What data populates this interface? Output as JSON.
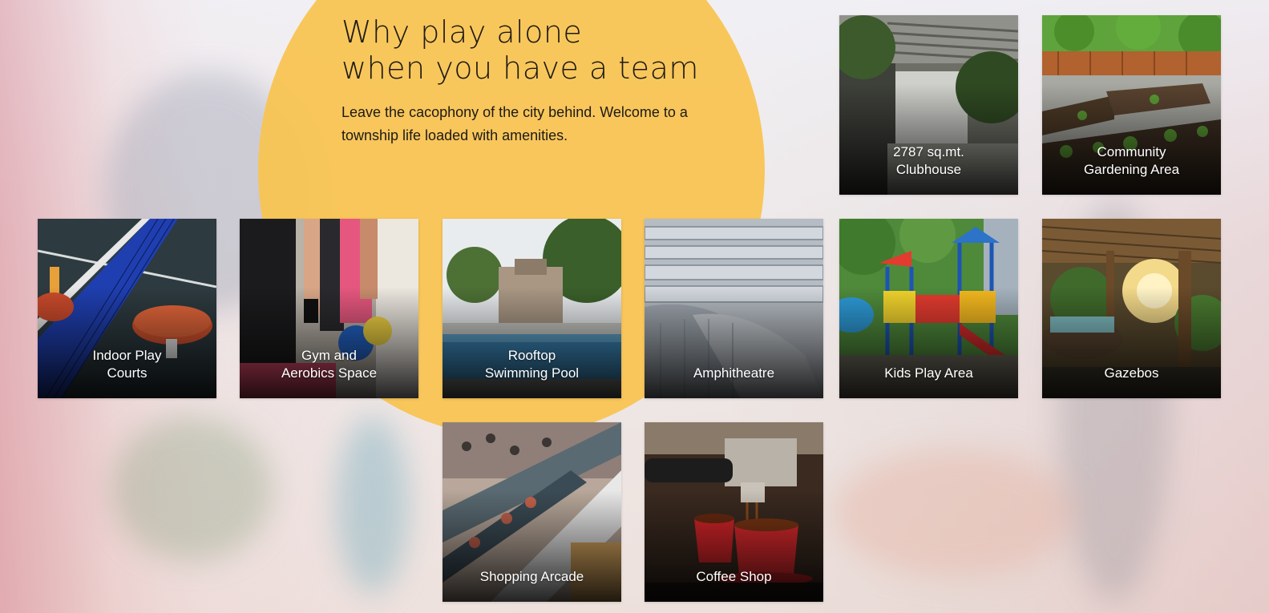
{
  "hero": {
    "headline_line1": "Why play alone",
    "headline_line2": "when you have a team",
    "intro": "Leave the cacophony of the city behind. Welcome to a township life loaded with amenities."
  },
  "amenities": [
    {
      "label": "2787 sq.mt.\nClubhouse",
      "icon": "clubhouse-photo"
    },
    {
      "label": "Community\nGardening Area",
      "icon": "garden-photo"
    },
    {
      "label": "Indoor Play\nCourts",
      "icon": "table-tennis-photo"
    },
    {
      "label": "Gym and\nAerobics Space",
      "icon": "gym-photo"
    },
    {
      "label": "Rooftop\nSwimming Pool",
      "icon": "pool-photo"
    },
    {
      "label": "Amphitheatre",
      "icon": "amphitheatre-photo"
    },
    {
      "label": "Kids Play Area",
      "icon": "playground-photo"
    },
    {
      "label": "Gazebos",
      "icon": "gazebo-photo"
    },
    {
      "label": "Shopping Arcade",
      "icon": "escalator-photo"
    },
    {
      "label": "Coffee Shop",
      "icon": "espresso-photo"
    }
  ],
  "colors": {
    "accent_circle": "#f8c452",
    "text_dark": "#1e1a16",
    "label_text": "#ffffff"
  }
}
